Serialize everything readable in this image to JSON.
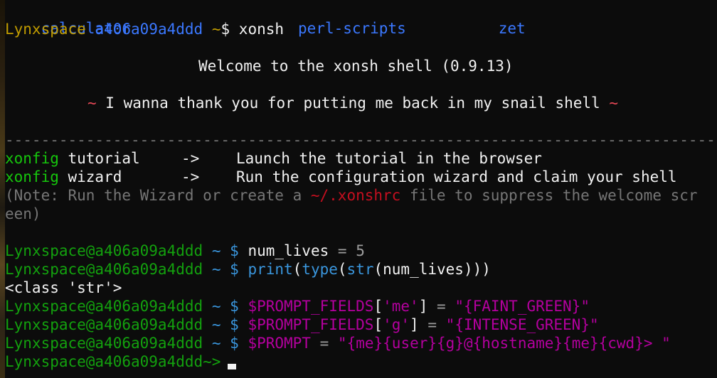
{
  "listing": [
    "calculator",
    "perl-scripts",
    "zet"
  ],
  "prompt1": {
    "user": "Lynxspace",
    "host": "a406a09a4ddd",
    "tilde": "~",
    "sign": "$",
    "cmd": "xonsh"
  },
  "welcome": {
    "title": "Welcome to the xonsh shell (0.9.13)",
    "tagline_tilde": "~",
    "tagline": " I wanna thank you for putting me back in my snail shell ",
    "separator": "-------------------------------------------------------------------------------"
  },
  "help": [
    {
      "cmd": "xonfig",
      "arg": " tutorial",
      "arrow": "->",
      "desc": "Launch the tutorial in the browser"
    },
    {
      "cmd": "xonfig",
      "arg": " wizard",
      "arrow": "->",
      "desc": "Run the configuration wizard and claim your shell"
    }
  ],
  "note": {
    "before": "(Note: Run the Wizard or create a ",
    "file": "~/.xonshrc",
    "after": " file to suppress the welcome scr",
    "wrap": "een)"
  },
  "prompt_label": "Lynxspace@a406a09a4ddd",
  "session": {
    "l1": {
      "var": "num_lives",
      "op": "=",
      "val": "5"
    },
    "l2": {
      "f1": "print",
      "f2": "type",
      "f3": "str",
      "arg": "num_lives"
    },
    "l3_out": "<class 'str'>",
    "l4": {
      "var": "$PROMPT_FIELDS",
      "key": "'me'",
      "val": "\"{FAINT_GREEN}\""
    },
    "l5": {
      "var": "$PROMPT_FIELDS",
      "key": "'g'",
      "val": "\"{INTENSE_GREEN}\""
    },
    "l6": {
      "var": "$PROMPT",
      "q": "\"",
      "me": "{me}",
      "user": "{user}",
      "g": "{g}",
      "at": "@",
      "hostname": "{hostname}",
      "me2": "{me}",
      "cwd": "{cwd}",
      "tail": "> \""
    },
    "final_prompt": "Lynxspace@a406a09a4ddd~>"
  },
  "colors": {
    "background": "#0c0c0c",
    "blue": "#3b78ff",
    "yellow": "#c19c00",
    "green": "#16c60c",
    "red": "#e74856",
    "magenta": "#b4009e"
  }
}
